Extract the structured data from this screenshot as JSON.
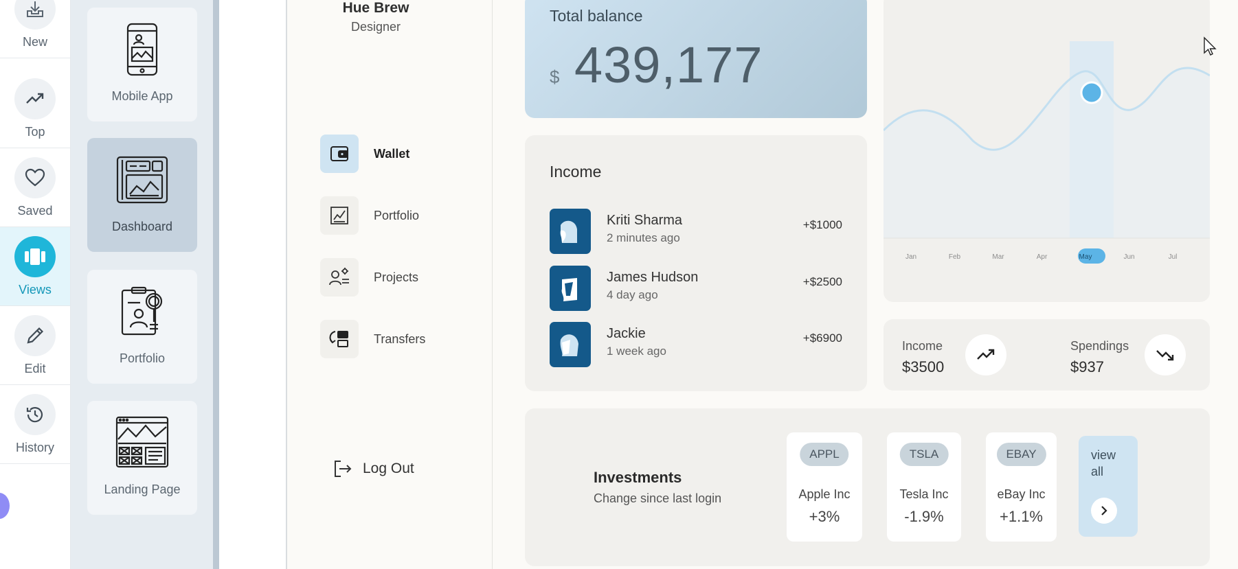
{
  "rail": {
    "items": [
      {
        "label": "New",
        "icon": "inbox-tray-icon"
      },
      {
        "label": "Top",
        "icon": "trending-up-icon"
      },
      {
        "label": "Saved",
        "icon": "heart-icon"
      },
      {
        "label": "Views",
        "icon": "carousel-icon",
        "active": true
      },
      {
        "label": "Edit",
        "icon": "pencil-icon"
      },
      {
        "label": "History",
        "icon": "history-icon"
      }
    ]
  },
  "templates": {
    "items": [
      {
        "label": "Mobile App",
        "icon": "mobile-app-icon"
      },
      {
        "label": "Dashboard",
        "icon": "dashboard-icon",
        "selected": true
      },
      {
        "label": "Portfolio",
        "icon": "portfolio-icon"
      },
      {
        "label": "Landing Page",
        "icon": "landing-page-icon"
      }
    ]
  },
  "profile": {
    "name": "Hue Brew",
    "role": "Designer"
  },
  "nav": {
    "items": [
      {
        "label": "Wallet",
        "icon": "wallet-icon",
        "active": true
      },
      {
        "label": "Portfolio",
        "icon": "chart-icon"
      },
      {
        "label": "Projects",
        "icon": "projects-icon"
      },
      {
        "label": "Transfers",
        "icon": "transfer-icon"
      }
    ],
    "logout": "Log Out"
  },
  "balance": {
    "title": "Total balance",
    "currency": "$",
    "amount": "439,177"
  },
  "income": {
    "title": "Income",
    "rows": [
      {
        "name": "Kriti Sharma",
        "time": "2 minutes ago",
        "amount": "+$1000"
      },
      {
        "name": "James Hudson",
        "time": "4 day ago",
        "amount": "+$2500"
      },
      {
        "name": "Jackie",
        "time": "1 week ago",
        "amount": "+$6900"
      }
    ]
  },
  "chart_data": {
    "type": "line",
    "categories": [
      "Jan",
      "Feb",
      "Mar",
      "Apr",
      "May",
      "Jun",
      "Jul"
    ],
    "highlight": "May",
    "title": "",
    "xlabel": "",
    "ylabel": ""
  },
  "stats": {
    "income_label": "Income",
    "income_value": "$3500",
    "spend_label": "Spendings",
    "spend_value": "$937"
  },
  "investments": {
    "title": "Investments",
    "subtitle": "Change since last login",
    "stocks": [
      {
        "ticker": "APPL",
        "name": "Apple Inc",
        "change": "+3%"
      },
      {
        "ticker": "TSLA",
        "name": "Tesla Inc",
        "change": "-1.9%"
      },
      {
        "ticker": "EBAY",
        "name": "eBay Inc",
        "change": "+1.1%"
      }
    ],
    "view_all": "view all"
  },
  "colors": {
    "accent": "#1fb6d9",
    "brand_dark": "#14598a",
    "chart_line": "#c3dff0",
    "chart_point": "#5cb4e6"
  }
}
